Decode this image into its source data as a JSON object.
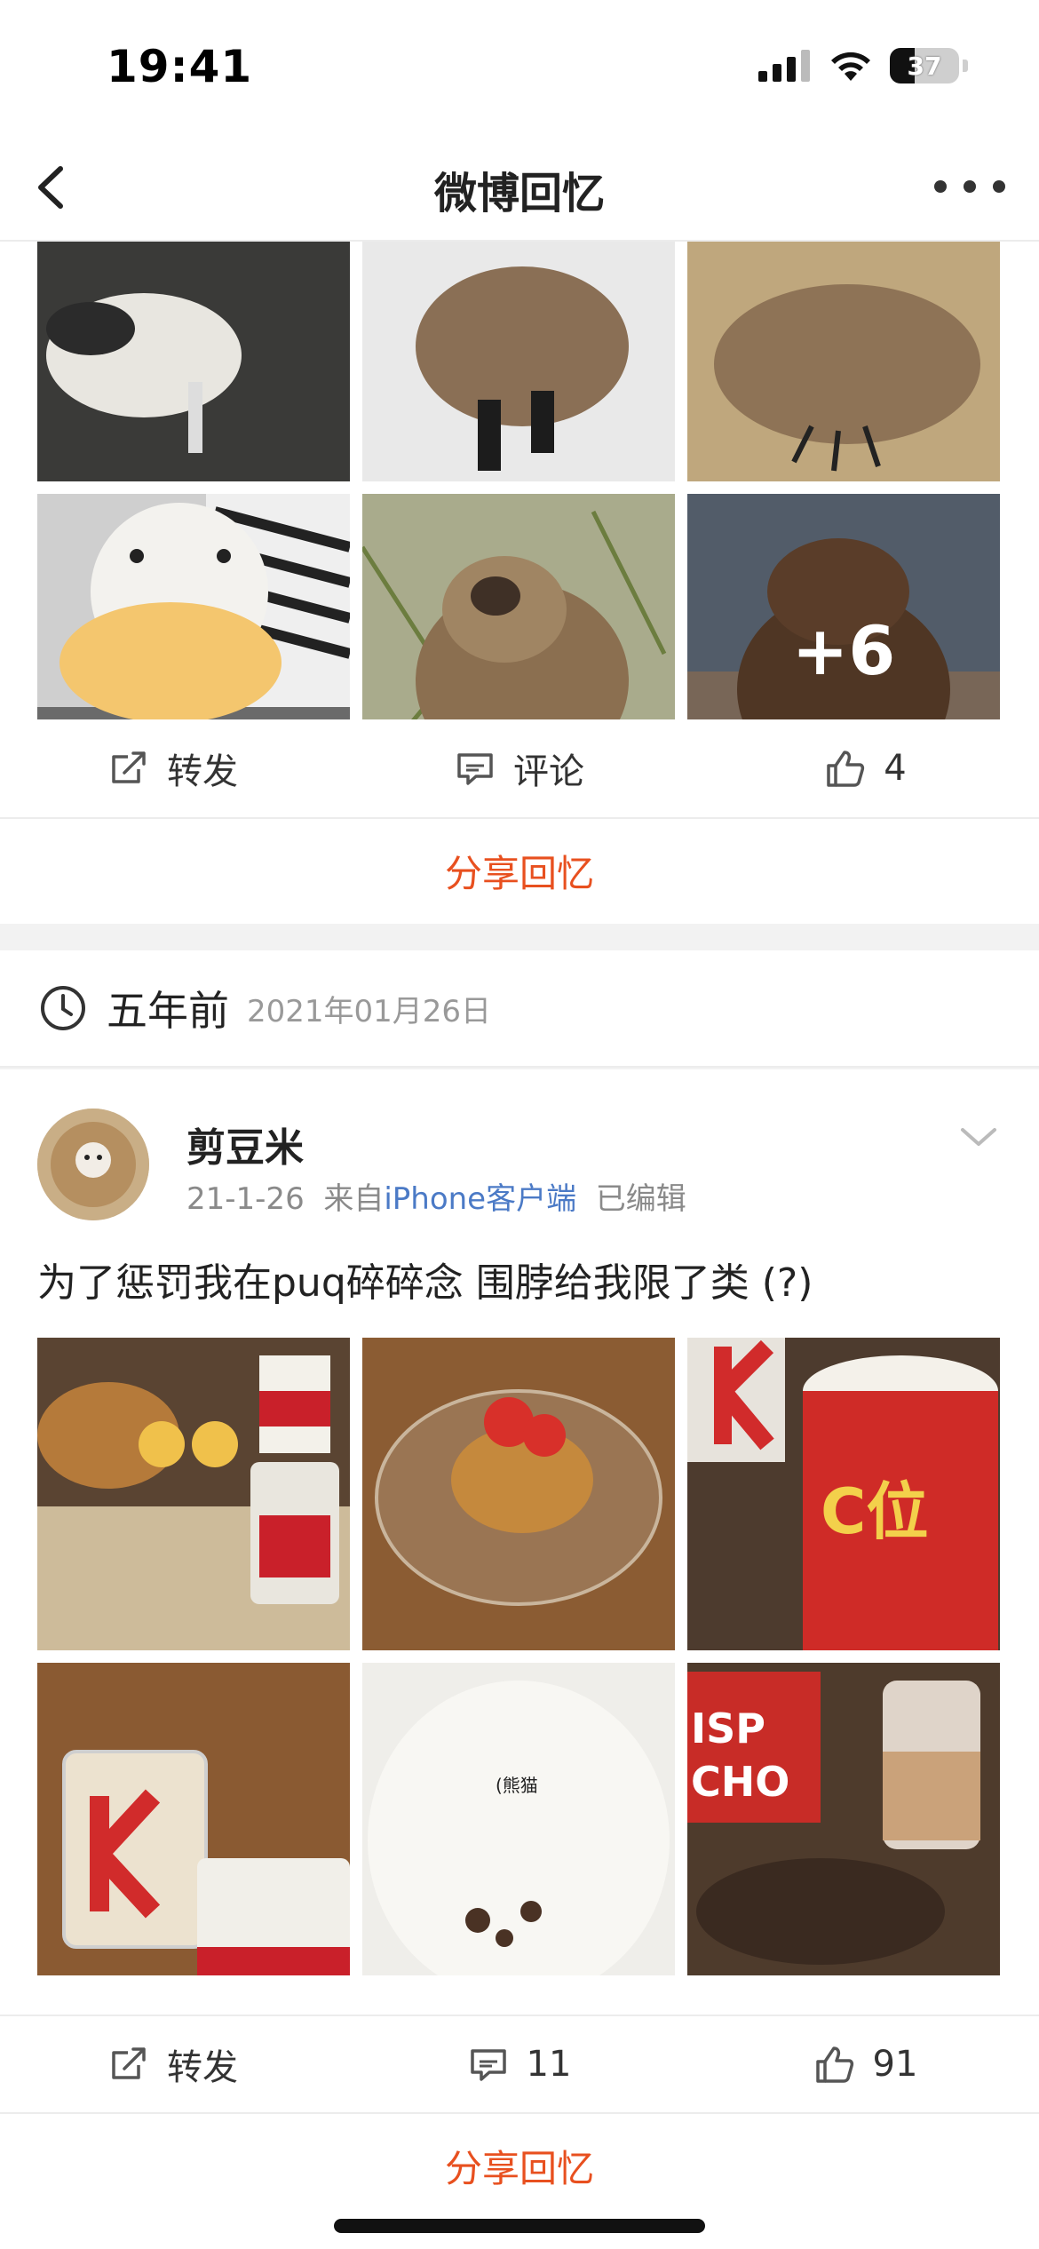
{
  "status_bar": {
    "time": "19:41",
    "battery": "37"
  },
  "nav": {
    "title": "微博回忆"
  },
  "memory1": {
    "more_count": "+6",
    "actions": {
      "repost": "转发",
      "comment": "评论",
      "likes": "4"
    },
    "share": "分享回忆"
  },
  "memory2": {
    "time_ago": "五年前",
    "date": "2021年01月26日",
    "post": {
      "user_name": "剪豆米",
      "date": "21-1-26",
      "source_prefix": "来自",
      "source": "iPhone客户端",
      "edited": "已编辑",
      "text": "为了惩罚我在puq碎碎念 围脖给我限了类 (?)",
      "photo_caption": "(熊猫",
      "actions": {
        "repost": "转发",
        "comments": "11",
        "likes": "91"
      },
      "share": "分享回忆"
    }
  },
  "colors": {
    "accent": "#e8501f",
    "link": "#4b7ac6"
  }
}
